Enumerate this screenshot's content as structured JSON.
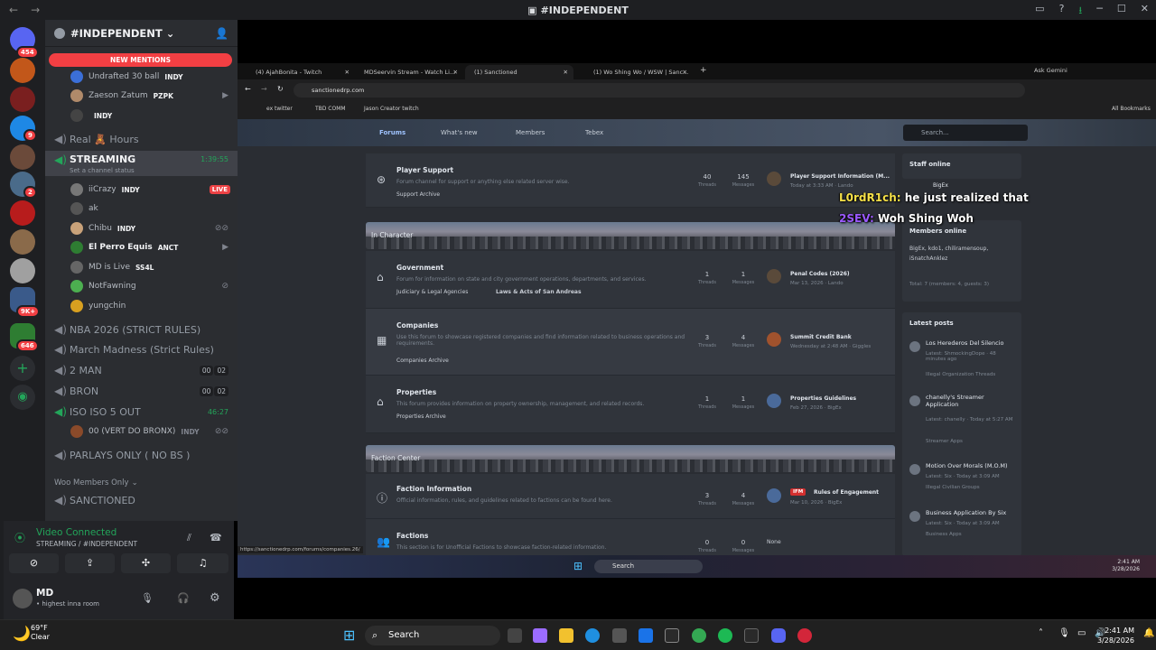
{
  "titlebar": {
    "title": "#INDEPENDENT"
  },
  "rail": {
    "badges": [
      "454",
      "9",
      "2",
      "9K+",
      "646"
    ]
  },
  "channels": {
    "server_name": "#INDEPENDENT",
    "new_mentions": "NEW MENTIONS",
    "items": [
      {
        "kind": "user",
        "name": "Undrafted 30 ball",
        "tag": "INDY"
      },
      {
        "kind": "user",
        "name": "Zaeson Zatum",
        "tag": "PZPK"
      },
      {
        "kind": "user",
        "name": "",
        "tag": "INDY"
      },
      {
        "kind": "channel",
        "name": "Real 🧸 Hours"
      },
      {
        "kind": "channel",
        "name": "STREAMING",
        "time": "1:39:55",
        "sub": "Set a channel status"
      },
      {
        "kind": "user",
        "name": "iiCrazy",
        "tag": "INDY",
        "live": "LIVE"
      },
      {
        "kind": "user",
        "name": "ak"
      },
      {
        "kind": "user",
        "name": "Chibu",
        "tag": "INDY"
      },
      {
        "kind": "user",
        "name": "El Perro Equis",
        "tag": "ANCT"
      },
      {
        "kind": "user",
        "name": "MD is Live",
        "tag": "SS4L"
      },
      {
        "kind": "user",
        "name": "NotFawning"
      },
      {
        "kind": "user",
        "name": "yungchin"
      },
      {
        "kind": "channel",
        "name": "NBA 2026 (STRICT RULES)"
      },
      {
        "kind": "channel",
        "name": "March Madness (Strict Rules)"
      },
      {
        "kind": "channel",
        "name": "2 MAN",
        "count": [
          "00",
          "02"
        ]
      },
      {
        "kind": "channel",
        "name": "BRON",
        "count": [
          "00",
          "02"
        ]
      },
      {
        "kind": "channel",
        "name": "ISO ISO 5 OUT",
        "time": "46:27"
      },
      {
        "kind": "user",
        "name": "00 (VERT DO BRONX)",
        "tag": "INDY"
      },
      {
        "kind": "channel",
        "name": "PARLAYS ONLY ( NO BS )"
      },
      {
        "kind": "category",
        "name": "Woo Members Only"
      },
      {
        "kind": "channel",
        "name": "SANCTIONED"
      }
    ]
  },
  "voice": {
    "status": "Video Connected",
    "sub": "STREAMING / #INDEPENDENT",
    "user": "MD",
    "user_status": "• highest inna room"
  },
  "browser": {
    "tabs": [
      "(4) AjahBonita - Twitch",
      "MDSeervin Stream - Watch Li...",
      "(1) Sanctioned",
      "(1) Wo Shing Wo / WSW | Sanc..."
    ],
    "ask": "Ask Gemini",
    "url": "sanctionedrp.com",
    "bookmarks": [
      "ex twitter",
      "TBD COMM",
      "Jason Creator twitch"
    ],
    "all_bookmarks": "All Bookmarks",
    "forum_nav": [
      "Forums",
      "What's new",
      "Members",
      "Tebex"
    ],
    "search": "Search...",
    "status_url": "https://sanctionedrp.com/forums/companies.26/"
  },
  "forum": {
    "player_support": {
      "name": "Player Support",
      "desc": "Forum channel for support or anything else related server wise.",
      "sub": "Support Archive",
      "threads": "40",
      "messages": "145",
      "last_title": "Player Support Information (M...",
      "last_meta": "Today at 3:33 AM · Lando"
    },
    "in_character": "In Character",
    "government": {
      "name": "Government",
      "desc": "Forum for information on state and city government operations, departments, and services.",
      "sub": "Judiciary & Legal Agencies",
      "sub2": "Laws & Acts of San Andreas",
      "threads": "1",
      "messages": "1",
      "last_title": "Penal Codes (2026)",
      "last_meta": "Mar 13, 2026 · Lando"
    },
    "companies": {
      "name": "Companies",
      "desc": "Use this forum to showcase registered companies and find information related to business operations and requirements.",
      "sub": "Companies Archive",
      "threads": "3",
      "messages": "4",
      "last_title": "Summit Credit Bank",
      "last_meta": "Wednesday at 2:48 AM · Giggles"
    },
    "properties": {
      "name": "Properties",
      "desc": "This forum provides information on property ownership, management, and related records.",
      "sub": "Properties Archive",
      "threads": "1",
      "messages": "1",
      "last_title": "Properties Guidelines",
      "last_meta": "Feb 27, 2026 · BigEx"
    },
    "faction_center": "Faction Center",
    "faction_info": {
      "name": "Faction Information",
      "desc": "Official information, rules, and guidelines related to factions can be found here.",
      "threads": "3",
      "messages": "4",
      "prefix": "IFM",
      "last_title": "Rules of Engagement",
      "last_meta": "Mar 10, 2026 · BigEx"
    },
    "factions": {
      "name": "Factions",
      "desc": "This section is for Unofficial Factions to showcase faction-related information.",
      "threads": "0",
      "messages": "0",
      "last_title": "None"
    },
    "labels": {
      "threads": "Threads",
      "messages": "Messages"
    }
  },
  "sidebar": {
    "staff_head": "Staff online",
    "staff": "BigEx",
    "members_head": "Members online",
    "members": "BigEx, kdo1, chiliramensoup, iSnatchAnklez",
    "total": "Total: 7 (members: 4, guests: 3)",
    "latest_head": "Latest posts",
    "posts": [
      {
        "title": "Los Herederos Del Silencio",
        "meta": "Latest: ShmockingDope · 48 minutes ago",
        "forum": "Illegal Organization Threads"
      },
      {
        "title": "chanelly's Streamer Application",
        "meta": "Latest: chanelly · Today at 5:27 AM",
        "forum": "Streamer Apps"
      },
      {
        "title": "Motion Over Morals (M.O.M)",
        "meta": "Latest: Six · Today at 3:09 AM",
        "forum": "Illegal Civilian Groups"
      },
      {
        "title": "Business Application By Six",
        "meta": "Latest: Six · Today at 3:09 AM",
        "forum": "Business Apps"
      }
    ]
  },
  "chat": [
    {
      "user": "L0rdR1ch:",
      "msg": "he just realized that",
      "color": "#f5e048"
    },
    {
      "user": "2SEV:",
      "msg": "Woh Shing Woh",
      "color": "#9b59ff"
    }
  ],
  "inner_taskbar": {
    "search": "Search",
    "time": "2:41 AM",
    "date": "3/28/2026"
  },
  "taskbar": {
    "weather_temp": "69°F",
    "weather_desc": "Clear",
    "search": "Search",
    "time": "2:41 AM",
    "date": "3/28/2026"
  }
}
